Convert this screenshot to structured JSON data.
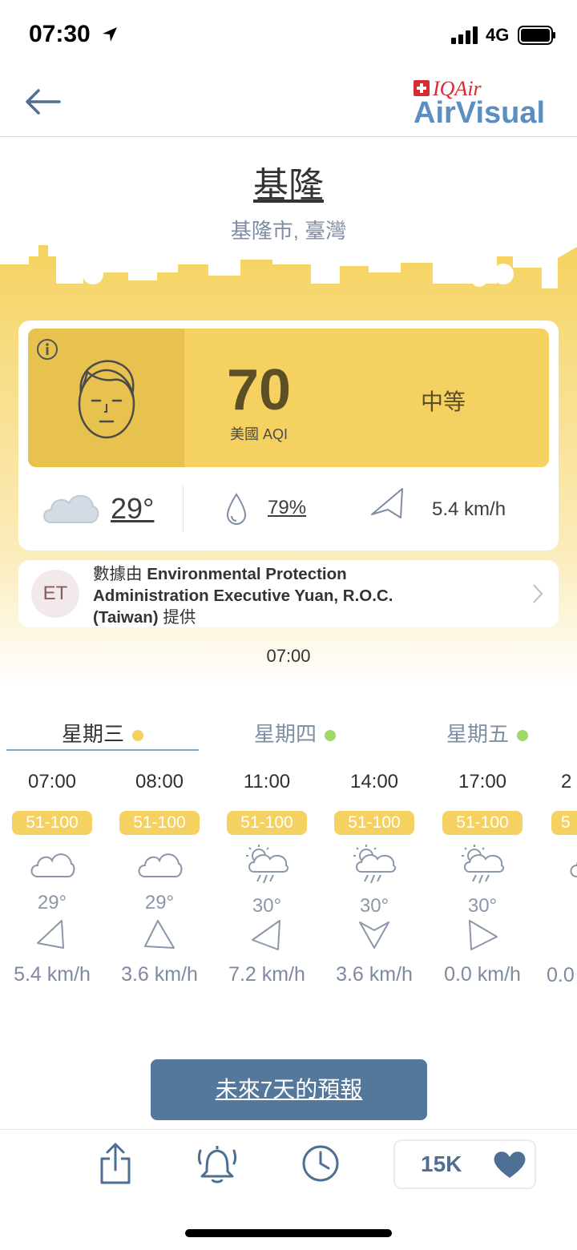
{
  "status_bar": {
    "time": "07:30",
    "network": "4G"
  },
  "header": {
    "brand_top": "IQAir",
    "brand_main": "AirVisual"
  },
  "location": {
    "city": "基隆",
    "region": "基隆市, 臺灣"
  },
  "aqi": {
    "value": "70",
    "label": "美國 AQI",
    "level": "中等",
    "color": "#f4d161"
  },
  "weather": {
    "temp": "29°",
    "humidity": "79%",
    "wind": "5.4 km/h"
  },
  "source": {
    "initials": "ET",
    "prefix": "數據由 ",
    "name_line1": "Environmental Protection",
    "name_line2": "Administration Executive Yuan, R.O.C.",
    "name_line3": "(Taiwan)",
    "suffix": " 提供"
  },
  "update_time": "07:00",
  "day_tabs": [
    {
      "label": "星期三",
      "dot_color": "#f4d161"
    },
    {
      "label": "星期四",
      "dot_color": "#a2d86a"
    },
    {
      "label": "星期五",
      "dot_color": "#a2d86a"
    }
  ],
  "hourly": [
    {
      "time": "07:00",
      "aqi": "51-100",
      "icon": "cloud-icon",
      "temp": "29°",
      "wind": "5.4 km/h"
    },
    {
      "time": "08:00",
      "aqi": "51-100",
      "icon": "cloud-icon",
      "temp": "29°",
      "wind": "3.6 km/h"
    },
    {
      "time": "11:00",
      "aqi": "51-100",
      "icon": "sun-rain-cloud-icon",
      "temp": "30°",
      "wind": "7.2 km/h"
    },
    {
      "time": "14:00",
      "aqi": "51-100",
      "icon": "sun-rain-cloud-icon",
      "temp": "30°",
      "wind": "3.6 km/h"
    },
    {
      "time": "17:00",
      "aqi": "51-100",
      "icon": "sun-rain-cloud-icon",
      "temp": "30°",
      "wind": "0.0 km/h"
    },
    {
      "time": "2",
      "aqi": "5",
      "icon": "cloud-icon",
      "temp": "",
      "wind": "0.0"
    }
  ],
  "forecast_button": "未來7天的預報",
  "bottom_bar": {
    "likes": "15K"
  }
}
